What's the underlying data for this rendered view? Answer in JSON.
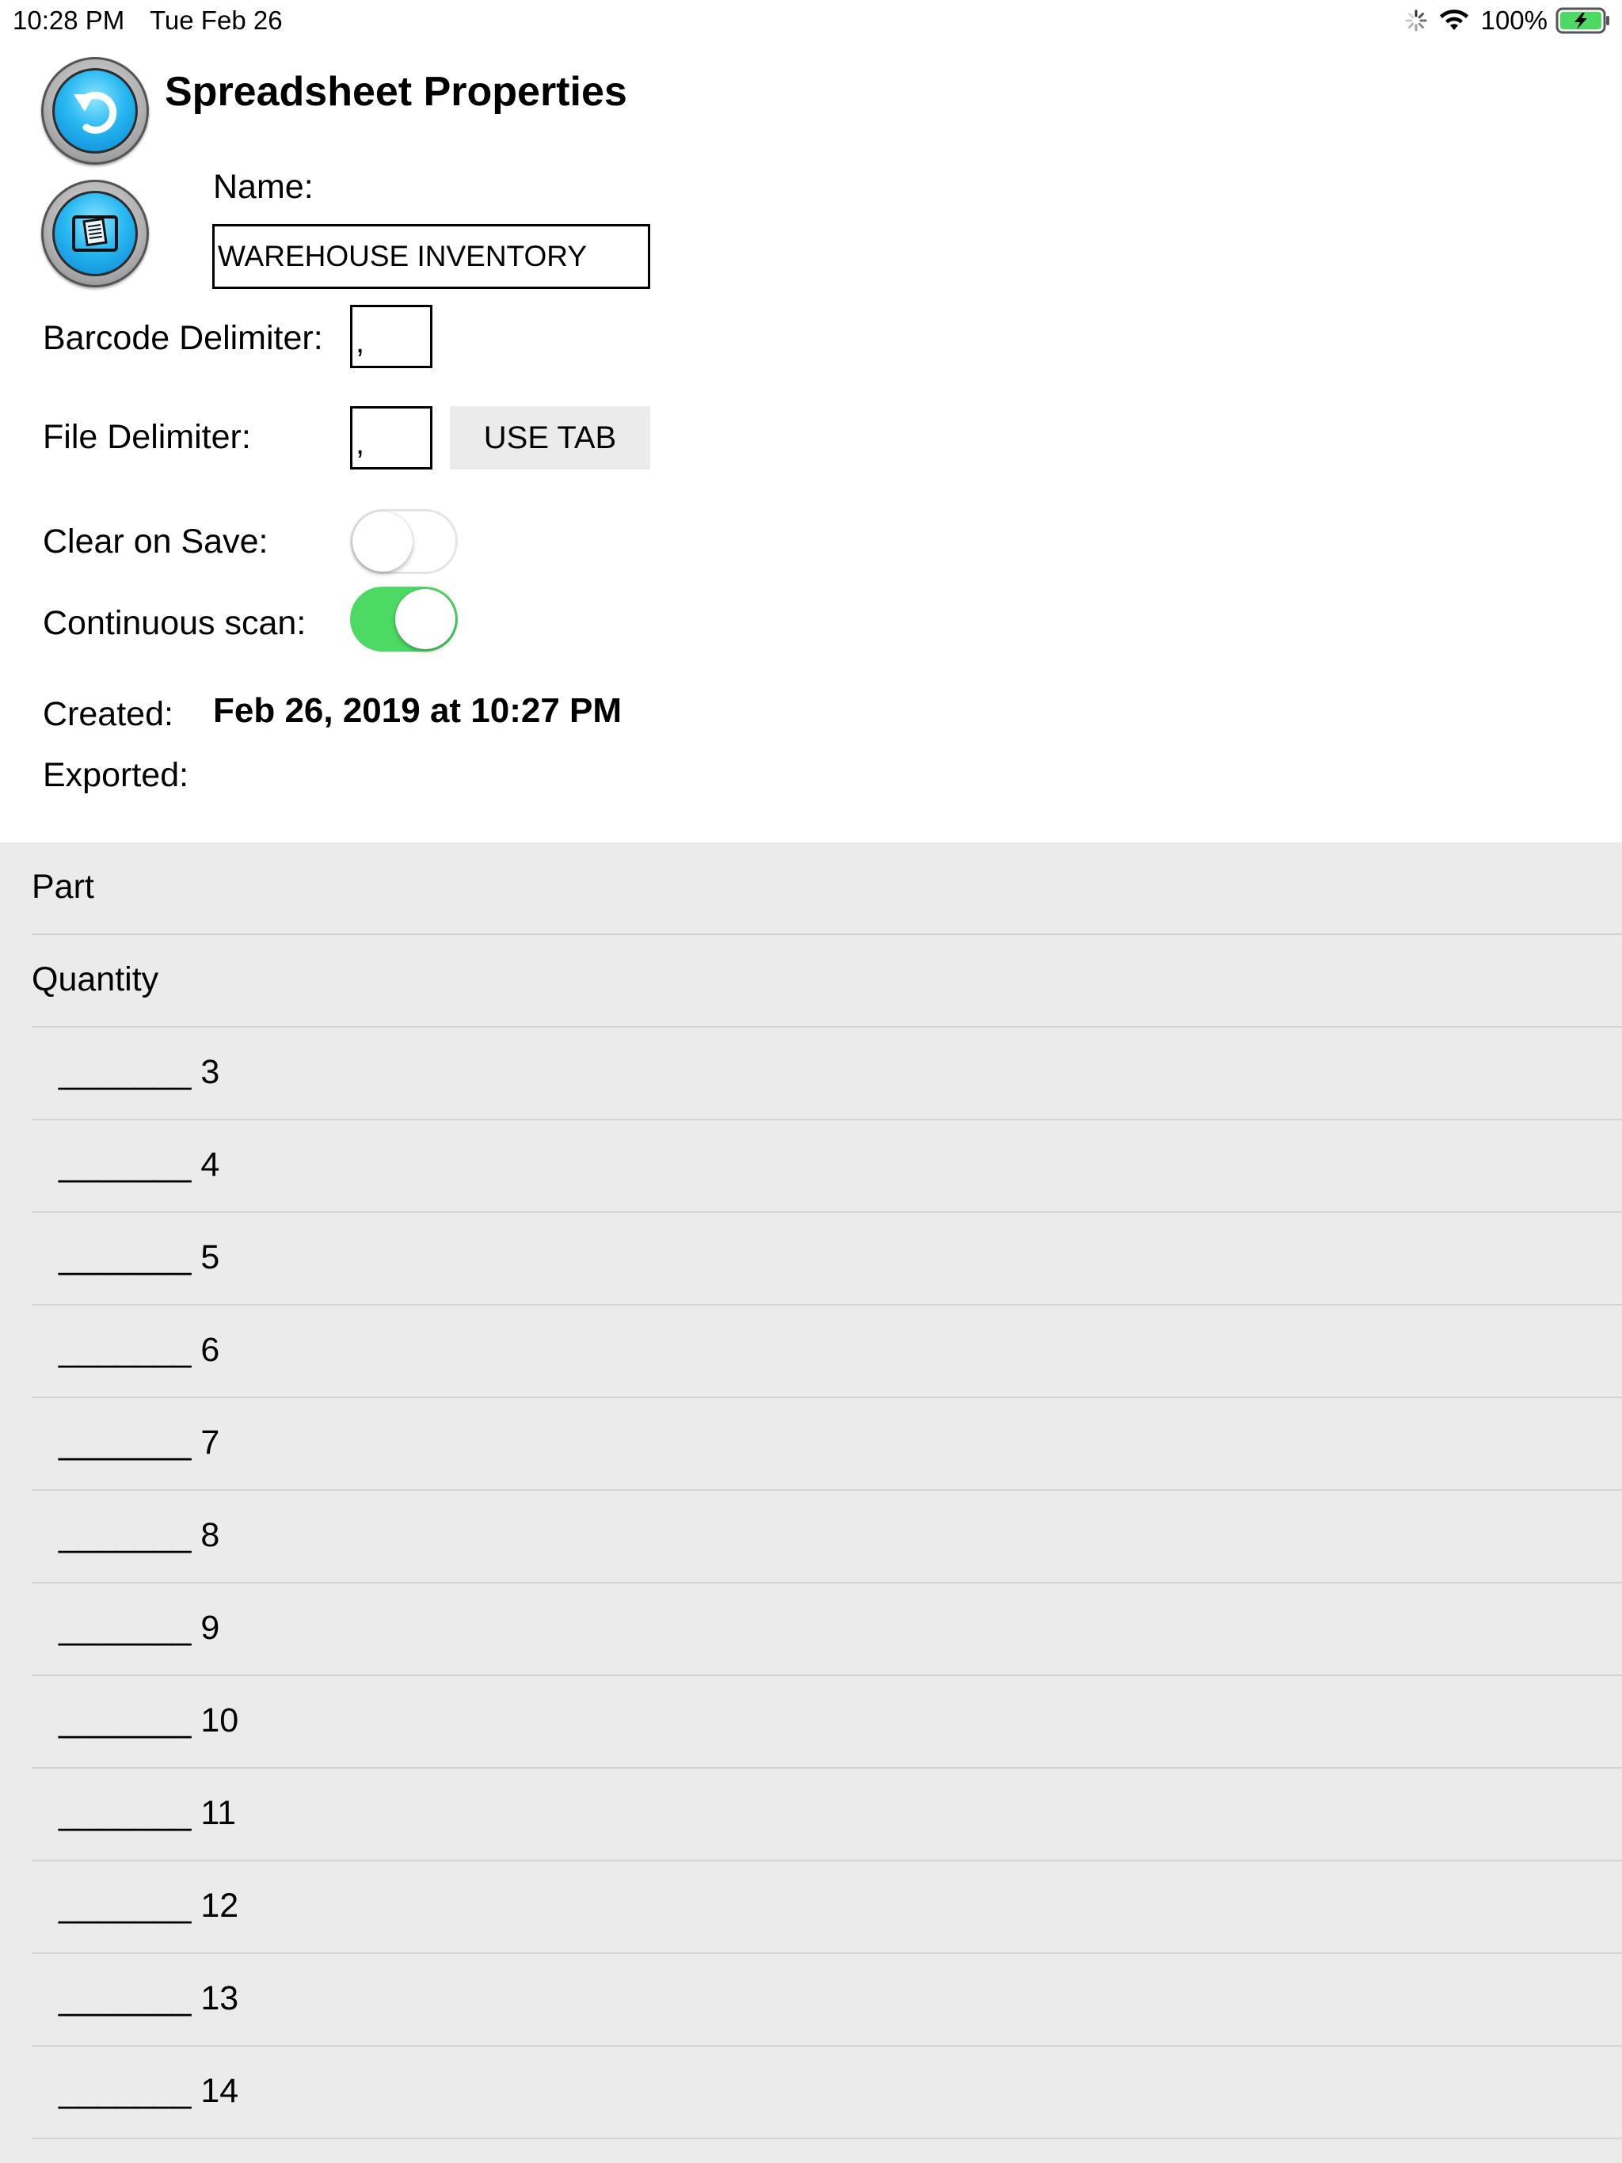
{
  "status_bar": {
    "time": "10:28 PM",
    "date": "Tue Feb 26",
    "battery_percent": "100%",
    "icons": [
      "activity-spinner-icon",
      "wifi-icon",
      "battery-charging-icon"
    ]
  },
  "header": {
    "title": "Spreadsheet Properties",
    "back_icon": "back-arrow-icon",
    "export_icon": "export-document-icon"
  },
  "form": {
    "name_label": "Name:",
    "name_value": "WAREHOUSE INVENTORY",
    "barcode_delimiter_label": "Barcode Delimiter:",
    "barcode_delimiter_value": ",",
    "file_delimiter_label": "File Delimiter:",
    "file_delimiter_value": ",",
    "use_tab_label": "USE TAB",
    "clear_on_save_label": "Clear on Save:",
    "clear_on_save": false,
    "continuous_scan_label": "Continuous scan:",
    "continuous_scan": true,
    "created_label": "Created:",
    "created_value": "Feb 26, 2019 at 10:27 PM",
    "exported_label": "Exported:",
    "exported_value": ""
  },
  "columns": [
    "Part",
    "Quantity",
    "_______ 3",
    "_______ 4",
    "_______ 5",
    "_______ 6",
    "_______ 7",
    "_______ 8",
    "_______ 9",
    "_______ 10",
    "_______ 11",
    "_______ 12",
    "_______ 13",
    "_______ 14"
  ],
  "colors": {
    "toggle_on": "#4cd964",
    "list_background": "#ebebeb",
    "button_blue": "#28b8f2"
  }
}
